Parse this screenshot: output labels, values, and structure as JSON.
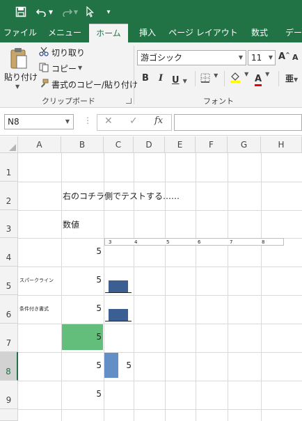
{
  "quick_access": {
    "save_icon": "save-icon",
    "undo_icon": "undo-icon",
    "redo_icon": "redo-icon",
    "pointer_icon": "pointer-icon",
    "customize_icon": "customize-icon"
  },
  "tabs": [
    {
      "label": "ファイル"
    },
    {
      "label": "メニュー"
    },
    {
      "label": "ホーム",
      "active": true
    },
    {
      "label": "挿入"
    },
    {
      "label": "ページ レイアウト"
    },
    {
      "label": "数式"
    },
    {
      "label": "データ"
    }
  ],
  "ribbon": {
    "clipboard": {
      "paste_label": "貼り付け",
      "cut_label": "切り取り",
      "copy_label": "コピー",
      "format_painter_label": "書式のコピー/貼り付け",
      "group_label": "クリップボード"
    },
    "font": {
      "font_name": "游ゴシック",
      "font_size": "11",
      "grow_label": "A",
      "shrink_label": "A",
      "bold_label": "B",
      "italic_label": "I",
      "underline_label": "U",
      "font_color_label": "A",
      "group_label": "フォント"
    }
  },
  "formula_bar": {
    "name_box": "N8",
    "cancel_label": "✕",
    "enter_label": "✓",
    "fx_label": "fx",
    "formula": ""
  },
  "sheet": {
    "columns": [
      "A",
      "B",
      "C",
      "D",
      "E",
      "F",
      "G",
      "H"
    ],
    "rows": [
      "1",
      "2",
      "3",
      "4",
      "5",
      "6",
      "7",
      "8",
      "9"
    ],
    "cells": {
      "B2": "右のコチラ側でテストする……",
      "B3": "数値",
      "B4": "5",
      "A5": "スパークライン",
      "B5": "5",
      "A6": "条件付き書式",
      "B6": "5",
      "B7": "5",
      "B8": "5",
      "C8": "5",
      "B9": "5"
    },
    "axis_labels": [
      "3",
      "4",
      "5",
      "6",
      "7",
      "8"
    ],
    "sparklines": {
      "row5_value": 5,
      "row6_value": 5,
      "axis_min": 3,
      "axis_max": 8
    },
    "data_bar_row8": {
      "value": 5
    },
    "colors": {
      "accent": "#217346",
      "sparkline_bar": "#3b5e93",
      "green_fill": "#63be7b",
      "data_bar": "#638ec6"
    }
  }
}
